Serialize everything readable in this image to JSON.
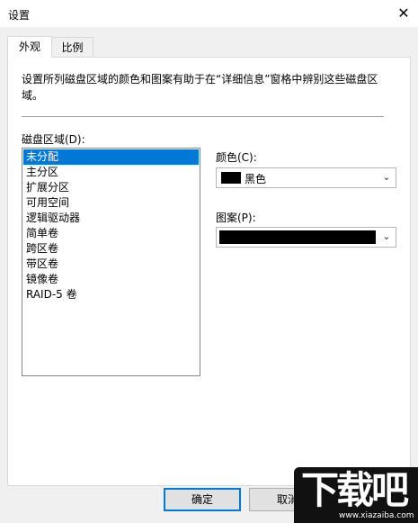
{
  "window": {
    "title": "设置",
    "close_glyph": "✕"
  },
  "tabs": [
    {
      "label": "外观",
      "active": true
    },
    {
      "label": "比例",
      "active": false
    }
  ],
  "description": "设置所列磁盘区域的颜色和图案有助于在“详细信息”窗格中辨别这些磁盘区域。",
  "disk_region": {
    "label": "磁盘区域(D):",
    "items": [
      "未分配",
      "主分区",
      "扩展分区",
      "可用空间",
      "逻辑驱动器",
      "简单卷",
      "跨区卷",
      "带区卷",
      "镜像卷",
      "RAID-5 卷"
    ],
    "selected": "未分配"
  },
  "color": {
    "label": "颜色(C):",
    "value": "黑色",
    "swatch_color": "#000000"
  },
  "pattern": {
    "label": "图案(P):",
    "value_color": "#000000"
  },
  "buttons": {
    "ok": "确定",
    "cancel": "取消"
  },
  "watermark": {
    "big": "下载吧",
    "small": "www.xiazaiba.com"
  },
  "colors": {
    "selection": "#0078d7",
    "accent_border": "#0078d7"
  }
}
